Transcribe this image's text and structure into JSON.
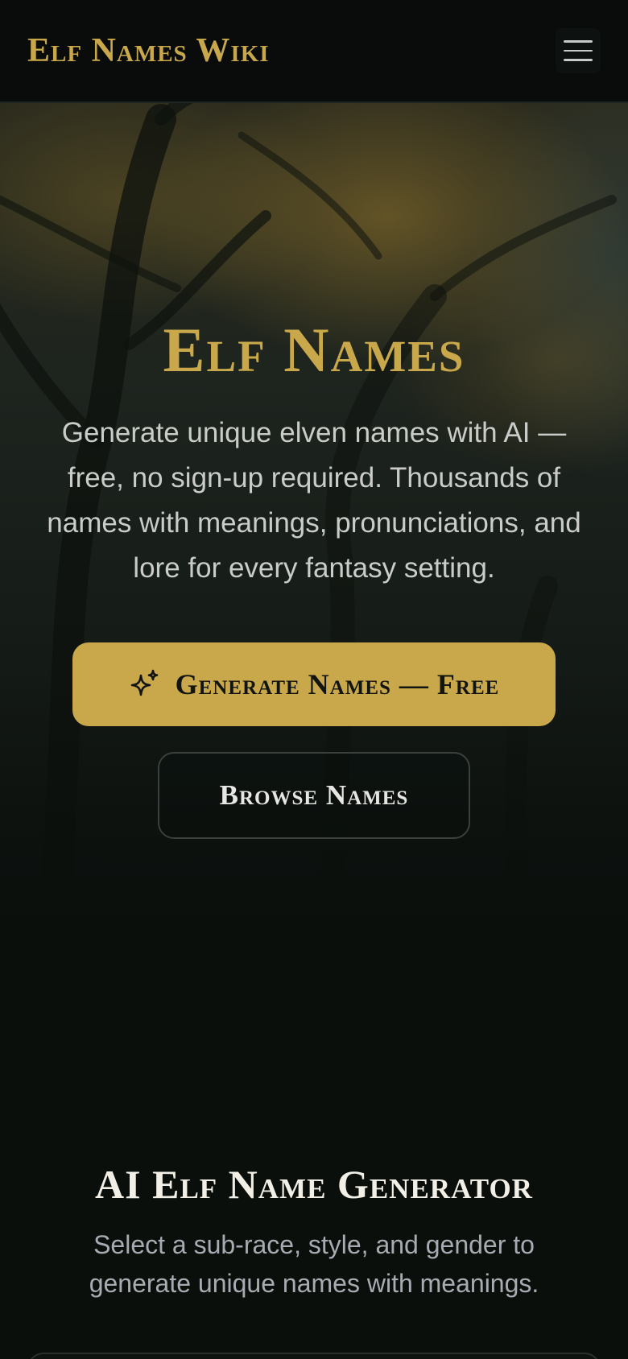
{
  "header": {
    "logo_text": "Elf Names Wiki",
    "menu_icon": "hamburger-menu-icon"
  },
  "hero": {
    "title": "Elf Names",
    "subtitle": "Generate unique elven names with AI — free, no sign-up required. Thousands of names with meanings, pronunciations, and lore for every fantasy setting.",
    "primary_button": {
      "icon": "sparkle-icon",
      "label": "Generate Names — Free"
    },
    "secondary_button": {
      "label": "Browse Names"
    }
  },
  "generator": {
    "title": "AI Elf Name Generator",
    "subtitle": "Select a sub-race, style, and gender to generate unique names with meanings."
  },
  "colors": {
    "accent_gold": "#c9a84c",
    "background": "#0b0f0c",
    "text_light": "#c9ccc8",
    "text_muted": "#a8acb2"
  }
}
